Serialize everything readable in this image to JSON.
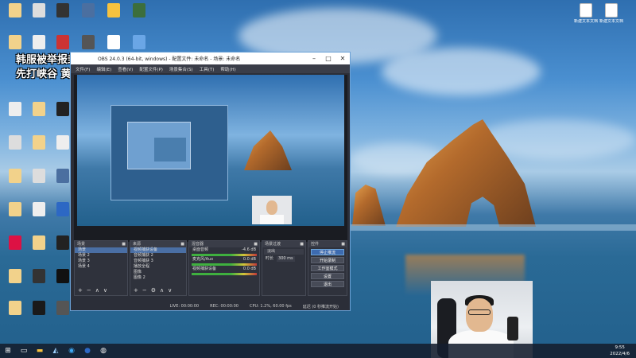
{
  "desktop": {
    "overlay_line1": "韩服被举报封号",
    "overlay_line2": "先打峡谷 黄金1",
    "right_icons": [
      {
        "label": "新建文本文档 (4)"
      },
      {
        "label": "新建文本文档 (5)"
      }
    ]
  },
  "obs": {
    "title": "OBS 24.0.3 (64-bit, windows) - 配置文件: 未命名 - 场景: 未命名",
    "menu": [
      "文件(F)",
      "编辑(E)",
      "查看(V)",
      "配置文件(P)",
      "场景集合(S)",
      "工具(T)",
      "帮助(H)"
    ],
    "docks": {
      "scenes": {
        "title": "场景",
        "items": [
          "场景",
          "场景 2",
          "场景 3",
          "场景 4"
        ]
      },
      "sources": {
        "title": "来源",
        "items": [
          "视频捕获设备",
          "音频捕获 2",
          "音频捕获 3",
          "播放全程",
          "图像",
          "图像 2",
          "图形"
        ]
      },
      "mixer": {
        "title": "混音器",
        "channels": [
          {
            "name": "桌面音频",
            "db": "-4.6 dB"
          },
          {
            "name": "麦克风/Aux",
            "db": "0.0 dB"
          },
          {
            "name": "视频捕获设备",
            "db": "0.0 dB"
          }
        ]
      },
      "transitions": {
        "title": "场景过渡",
        "type": "淡出",
        "duration_label": "时长",
        "duration": "300 ms"
      },
      "controls": {
        "title": "控件",
        "buttons": [
          "停止推流",
          "开始录制",
          "工作室模式",
          "设置",
          "退出"
        ]
      }
    },
    "status": {
      "live": "LIVE: 00:00:00",
      "rec": "REC: 00:00:00",
      "cpu": "CPU: 1.2%, 60.00 fps",
      "dropped": "延迟 (0 秒推流开始)"
    }
  },
  "taskbar": {
    "time": "9:55",
    "date": "2022/4/6"
  }
}
